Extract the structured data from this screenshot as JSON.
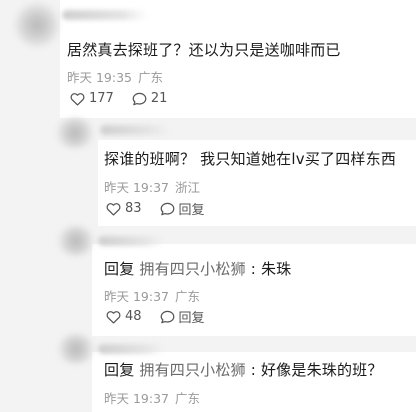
{
  "comments": [
    {
      "text": "居然真去探班了？还以为只是送咖啡而已",
      "time": "昨天 19:35",
      "location": "广东",
      "likes": "177",
      "replies": "21"
    },
    {
      "text": "探谁的班啊？ 我只知道她在lv买了四样东西",
      "time": "昨天 19:37",
      "location": "浙江",
      "likes": "83",
      "reply_label": "回复"
    },
    {
      "reply_word": "回复",
      "mention": "拥有四只小松狮",
      "sep": " : ",
      "text": "朱珠",
      "time": "昨天 19:37",
      "location": "广东",
      "likes": "48",
      "reply_label": "回复"
    },
    {
      "reply_word": "回复",
      "mention": "拥有四只小松狮",
      "sep": " : ",
      "text": "好像是朱珠的班？",
      "time": "昨天 19:37",
      "location": "广东"
    }
  ]
}
